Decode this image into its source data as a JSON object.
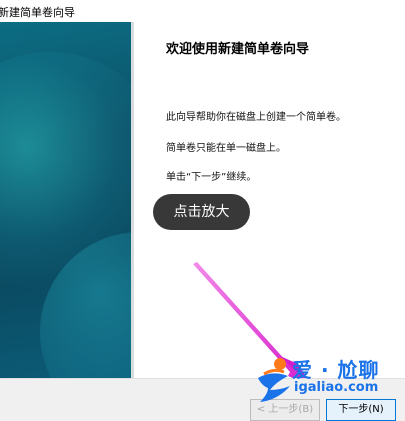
{
  "window": {
    "title": "新建简单卷向导"
  },
  "page": {
    "heading": "欢迎使用新建简单卷向导",
    "paragraphs": [
      "此向导帮助你在磁盘上创建一个简单卷。",
      "简单卷只能在单一磁盘上。",
      "单击“下一步”继续。"
    ]
  },
  "overlay": {
    "zoom_label": "点击放大"
  },
  "footer": {
    "back_label": "< 上一步(B)",
    "next_label": "下一步(N)"
  },
  "watermark": {
    "name": "爱 · 尬聊",
    "url": "igaliao.com"
  },
  "colors": {
    "arrow": "#e02ad8",
    "panel": "#0e4f66",
    "accent": "#0078d7",
    "watermark": "#1a73e8"
  }
}
